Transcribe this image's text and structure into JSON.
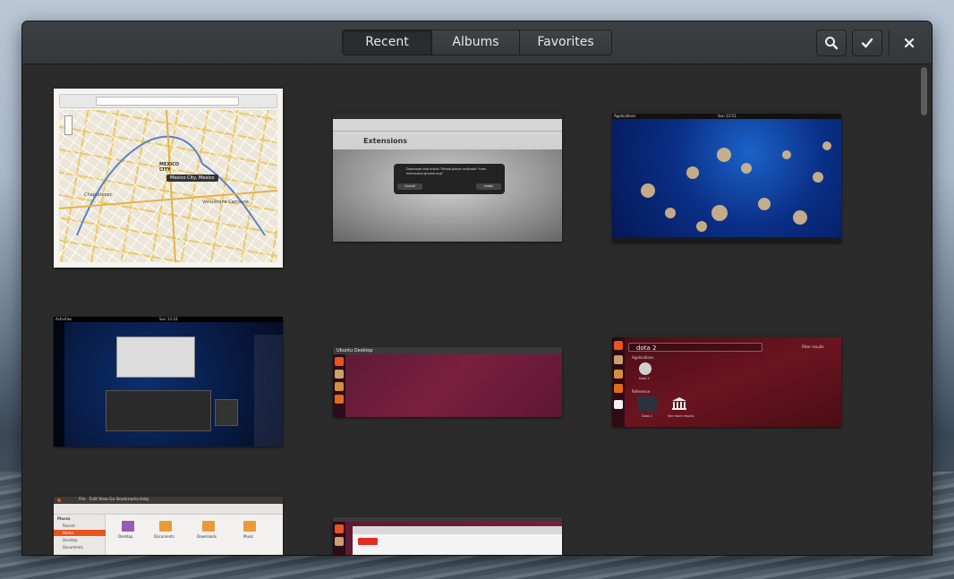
{
  "toolbar": {
    "tabs": [
      {
        "label": "Recent",
        "active": true
      },
      {
        "label": "Albums",
        "active": false
      },
      {
        "label": "Favorites",
        "active": false
      }
    ],
    "search_icon": "search-icon",
    "select_icon": "checkmark-icon",
    "close_icon": "close-icon"
  },
  "thumbnails": {
    "map": {
      "search_placeholder": "",
      "city_label": "MEXICO CITY",
      "tooltip": "Mexico City, Mexico",
      "place_1": "Chapultepec",
      "place_2": "Venustiano Carranza"
    },
    "extensions": {
      "site_title": "Extensions",
      "dialog_text": "Download and install \"Media player indicator\" from extensions.gnome.org?",
      "cancel": "Cancel",
      "install": "Install"
    },
    "jellyfish": {
      "activities": "Applications",
      "clock": "Sun 13:51"
    },
    "overview": {
      "activities": "Activities",
      "clock": "Sun 13:10"
    },
    "unity": {
      "title": "Ubuntu Desktop"
    },
    "dash": {
      "query": "dota 2",
      "filter": "Filter results",
      "section_apps": "Applications",
      "section_ref": "Reference",
      "app_1": "Dota 2",
      "ref_1": "Dota 2",
      "ref_2": "See more results"
    },
    "files": {
      "menu": [
        "File",
        "Edit",
        "View",
        "Go",
        "Bookmarks",
        "Help"
      ],
      "places_title": "Places",
      "places": [
        "Recent",
        "Home",
        "Desktop",
        "Documents"
      ],
      "folders": [
        "Desktop",
        "Documents",
        "Downloads",
        "Music"
      ]
    }
  },
  "colors": {
    "headerbar": "#3a3d3f",
    "content_bg": "#2b2b2b"
  }
}
